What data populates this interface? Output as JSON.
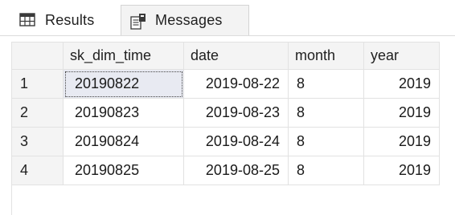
{
  "tabs": [
    {
      "label": "Results",
      "icon": "grid-icon"
    },
    {
      "label": "Messages",
      "icon": "messages-icon"
    }
  ],
  "grid": {
    "columns": [
      "sk_dim_time",
      "date",
      "month",
      "year"
    ],
    "rows": [
      {
        "num": "1",
        "sk_dim_time": "20190822",
        "date": "2019-08-22",
        "month": "8",
        "year": "2019"
      },
      {
        "num": "2",
        "sk_dim_time": "20190823",
        "date": "2019-08-23",
        "month": "8",
        "year": "2019"
      },
      {
        "num": "3",
        "sk_dim_time": "20190824",
        "date": "2019-08-24",
        "month": "8",
        "year": "2019"
      },
      {
        "num": "4",
        "sk_dim_time": "20190825",
        "date": "2019-08-25",
        "month": "8",
        "year": "2019"
      }
    ],
    "selected_cell": {
      "row": 0,
      "column": "sk_dim_time"
    }
  }
}
